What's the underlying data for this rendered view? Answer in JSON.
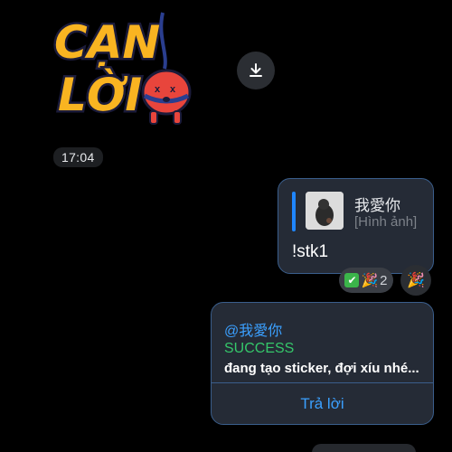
{
  "sticker": {
    "line1": "CẠN",
    "line2": "LỜI"
  },
  "download": {
    "icon": "download-icon"
  },
  "timestamp": "17:04",
  "outgoing": {
    "quote_name": "我愛你",
    "quote_sub": "[Hình ảnh]",
    "text": "!stk1",
    "reactions": {
      "count": "2",
      "icons": [
        "check-emoji-icon",
        "party-popper-icon"
      ]
    }
  },
  "incoming": {
    "mention": "@我愛你",
    "status": "SUCCESS",
    "message": "đang tạo sticker, đợi xíu nhé...",
    "reply_label": "Trả lời"
  },
  "colors": {
    "background": "#000000",
    "bubble": "#252b36",
    "bubble_border": "#3a5e8c",
    "accent_blue": "#1f86ff",
    "success_green": "#35c66a"
  }
}
